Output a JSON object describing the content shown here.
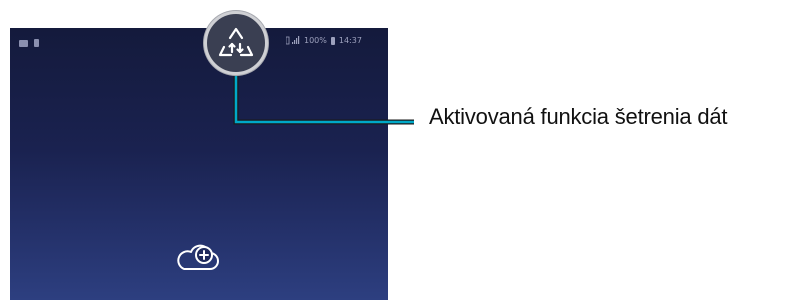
{
  "phone": {
    "status_bar": {
      "left_icons": [
        "image-notification-icon",
        "sd-card-icon"
      ],
      "signal_text": "▐.│l",
      "battery_percent": "100%",
      "time": "14:37"
    },
    "home": {
      "center_icon": "cloud-add-icon"
    }
  },
  "callout": {
    "icon": "data-saver-icon",
    "label": "Aktivovaná funkcia šetrenia dát"
  },
  "colors": {
    "screen_top": "#141a3c",
    "screen_bottom": "#2d3f80",
    "callout_line": "#00a9c8",
    "magnifier_bg": "#3a3f52"
  }
}
